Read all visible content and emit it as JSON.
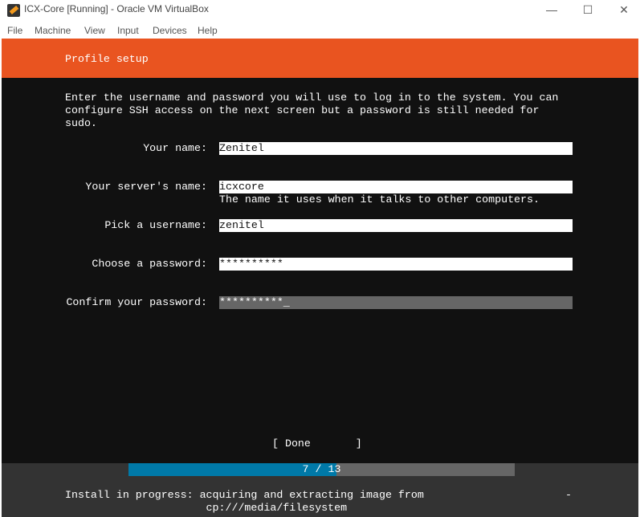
{
  "window": {
    "title": "ICX-Core [Running] - Oracle VM VirtualBox",
    "minimize": "—",
    "maximize": "☐",
    "close": "✕"
  },
  "menu": [
    "File",
    "Machine",
    "View",
    "Input",
    "Devices",
    "Help"
  ],
  "screen": {
    "title": "Profile setup",
    "intro": [
      "Enter the username and password you will use to log in to the system. You can",
      "configure SSH access on the next screen but a password is still needed for",
      "sudo."
    ],
    "fields": [
      {
        "label": "Your name:",
        "value": "Zenitel"
      },
      {
        "label": "Your server's name:",
        "value": "icxcore",
        "hint": "The name it uses when it talks to other computers."
      },
      {
        "label": "Pick a username:",
        "value": "zenitel"
      },
      {
        "label": "Choose a password:",
        "value": "**********"
      },
      {
        "label": "Confirm your password:",
        "value": "**********_"
      }
    ],
    "done_button": "[ Done       ]",
    "progress": {
      "current": 7,
      "total": 13,
      "text": "7 / 13",
      "fraction": 0.538
    },
    "status": [
      "Install in progress: acquiring and extracting image from",
      "                      cp:///media/filesystem"
    ],
    "spinner": "-"
  }
}
